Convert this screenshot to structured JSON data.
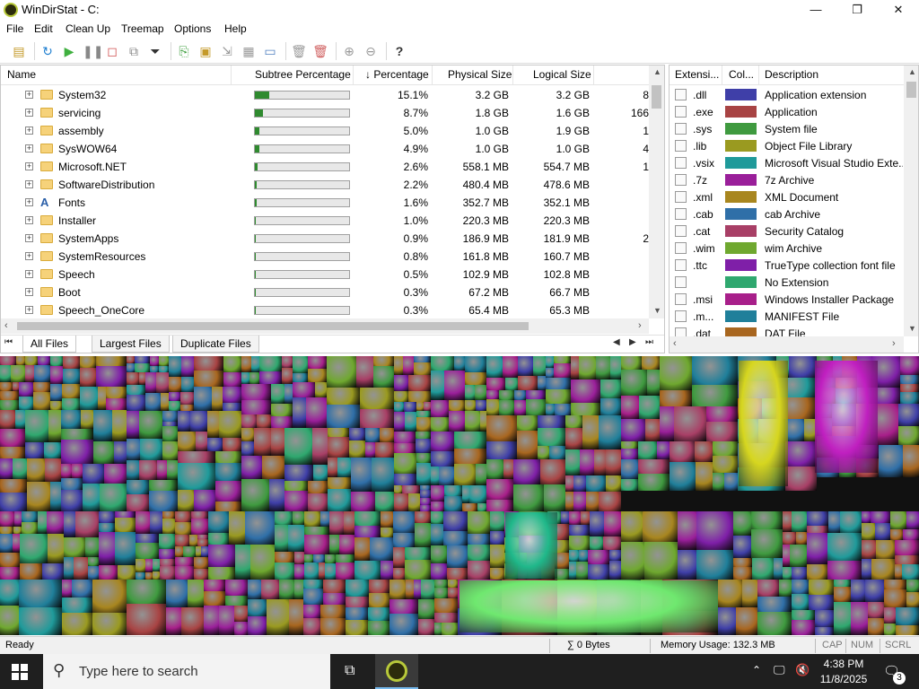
{
  "window": {
    "title": "WinDirStat - C:",
    "minimize_glyph": "—",
    "maximize_glyph": "❐",
    "close_glyph": "✕"
  },
  "menu": [
    "File",
    "Edit",
    "Clean Up",
    "Treemap",
    "Options",
    "Help"
  ],
  "toolbar": {
    "icons": [
      "open-icon",
      "refresh-icon",
      "play-icon",
      "pause-icon",
      "stop-icon",
      "refresh-selected-icon",
      "filter-icon",
      "copy-path-icon",
      "paste-icon",
      "explorer-icon",
      "properties-icon",
      "command-prompt-icon",
      "delete-icon",
      "delete-permanent-icon",
      "zoom-in-icon",
      "zoom-out-icon",
      "help-icon"
    ],
    "help_glyph": "?"
  },
  "tree": {
    "columns": [
      "Name",
      "Subtree Percentage",
      "↓ Percentage",
      "Physical Size",
      "Logical Size"
    ],
    "rows": [
      {
        "name": "System32",
        "subtree": 0.151,
        "pct": "15.1%",
        "phys": "3.2 GB",
        "log": "3.2 GB",
        "items": "8",
        "icon": "folder-icon"
      },
      {
        "name": "servicing",
        "subtree": 0.087,
        "pct": "8.7%",
        "phys": "1.8 GB",
        "log": "1.6 GB",
        "items": "166",
        "icon": "folder-icon"
      },
      {
        "name": "assembly",
        "subtree": 0.05,
        "pct": "5.0%",
        "phys": "1.0 GB",
        "log": "1.9 GB",
        "items": "1",
        "icon": "folder-icon"
      },
      {
        "name": "SysWOW64",
        "subtree": 0.049,
        "pct": "4.9%",
        "phys": "1.0 GB",
        "log": "1.0 GB",
        "items": "4",
        "icon": "folder-icon"
      },
      {
        "name": "Microsoft.NET",
        "subtree": 0.026,
        "pct": "2.6%",
        "phys": "558.1 MB",
        "log": "554.7 MB",
        "items": "1",
        "icon": "folder-icon"
      },
      {
        "name": "SoftwareDistribution",
        "subtree": 0.022,
        "pct": "2.2%",
        "phys": "480.4 MB",
        "log": "478.6 MB",
        "items": "",
        "icon": "folder-icon"
      },
      {
        "name": "Fonts",
        "subtree": 0.016,
        "pct": "1.6%",
        "phys": "352.7 MB",
        "log": "352.1 MB",
        "items": "",
        "icon": "font-folder-icon"
      },
      {
        "name": "Installer",
        "subtree": 0.01,
        "pct": "1.0%",
        "phys": "220.3 MB",
        "log": "220.3 MB",
        "items": "",
        "icon": "folder-icon"
      },
      {
        "name": "SystemApps",
        "subtree": 0.009,
        "pct": "0.9%",
        "phys": "186.9 MB",
        "log": "181.9 MB",
        "items": "2",
        "icon": "folder-icon"
      },
      {
        "name": "SystemResources",
        "subtree": 0.008,
        "pct": "0.8%",
        "phys": "161.8 MB",
        "log": "160.7 MB",
        "items": "",
        "icon": "folder-icon"
      },
      {
        "name": "Speech",
        "subtree": 0.005,
        "pct": "0.5%",
        "phys": "102.9 MB",
        "log": "102.8 MB",
        "items": "",
        "icon": "folder-icon"
      },
      {
        "name": "Boot",
        "subtree": 0.003,
        "pct": "0.3%",
        "phys": "67.2 MB",
        "log": "66.7 MB",
        "items": "",
        "icon": "folder-icon"
      },
      {
        "name": "Speech_OneCore",
        "subtree": 0.003,
        "pct": "0.3%",
        "phys": "65.4 MB",
        "log": "65.3 MB",
        "items": "",
        "icon": "folder-icon"
      }
    ]
  },
  "tabs": [
    "All Files",
    "Largest Files",
    "Duplicate Files"
  ],
  "extensions": {
    "columns": [
      "Extensi...",
      "Col...",
      "Description"
    ],
    "rows": [
      {
        "ext": ".dll",
        "color": "#3f3fa8",
        "desc": "Application extension"
      },
      {
        "ext": ".exe",
        "color": "#a84343",
        "desc": "Application"
      },
      {
        "ext": ".sys",
        "color": "#3f9a3f",
        "desc": "System file"
      },
      {
        "ext": ".lib",
        "color": "#9a9a20",
        "desc": "Object File Library"
      },
      {
        "ext": ".vsix",
        "color": "#1f9a9a",
        "desc": "Microsoft Visual Studio Exte..."
      },
      {
        "ext": ".7z",
        "color": "#9a1f9a",
        "desc": "7z Archive"
      },
      {
        "ext": ".xml",
        "color": "#a8861f",
        "desc": "XML Document"
      },
      {
        "ext": ".cab",
        "color": "#2f6fa8",
        "desc": "cab Archive"
      },
      {
        "ext": ".cat",
        "color": "#a83f66",
        "desc": "Security Catalog"
      },
      {
        "ext": ".wim",
        "color": "#6fa82f",
        "desc": "wim Archive"
      },
      {
        "ext": ".ttc",
        "color": "#7f1fa8",
        "desc": "TrueType collection font file"
      },
      {
        "ext": "",
        "color": "#2fa86f",
        "desc": "No Extension"
      },
      {
        "ext": ".msi",
        "color": "#a81f8a",
        "desc": "Windows Installer Package"
      },
      {
        "ext": ".m...",
        "color": "#1f7f9a",
        "desc": "MANIFEST File"
      },
      {
        "ext": ".dat",
        "color": "#a8661f",
        "desc": "DAT File"
      }
    ]
  },
  "status": {
    "left": "Ready",
    "sum": "∑ 0 Bytes",
    "memory": "Memory Usage: 132.3 MB",
    "cap": "CAP",
    "num": "NUM",
    "scrl": "SCRL"
  },
  "taskbar": {
    "search_placeholder": "Type here to search",
    "time": "4:38 PM",
    "date": "11/8/2025",
    "notifications": "3"
  }
}
